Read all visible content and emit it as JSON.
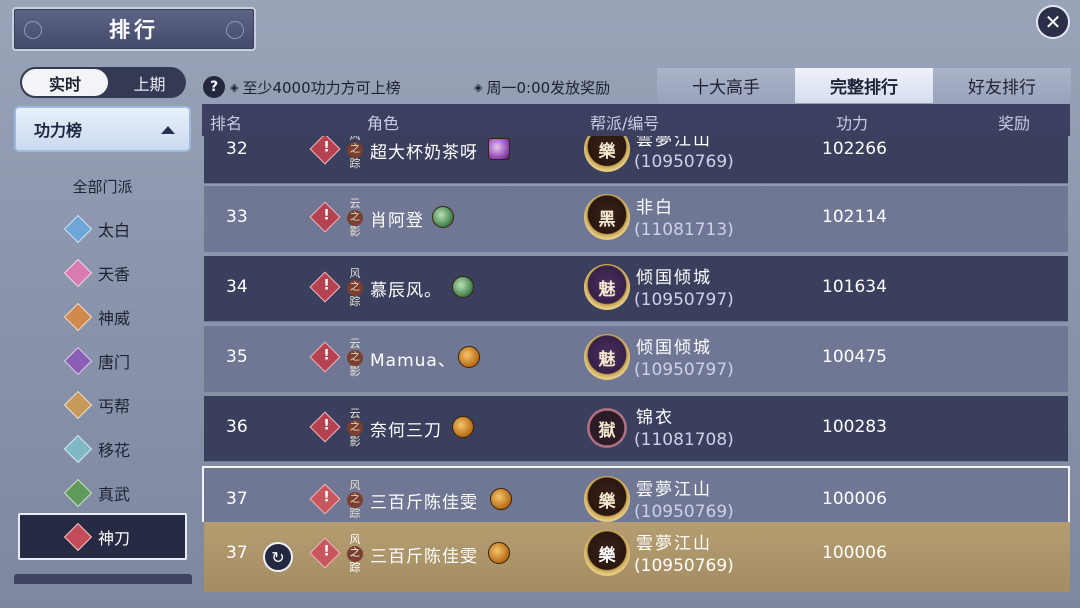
{
  "header": {
    "title": "排行",
    "close_icon": "close-icon"
  },
  "period_toggle": {
    "active": "实时",
    "inactive": "上期"
  },
  "category": {
    "label": "功力榜"
  },
  "sects": {
    "title": "全部门派",
    "items": [
      {
        "label": "太白",
        "color": "#6fa6d8"
      },
      {
        "label": "天香",
        "color": "#d77bb0"
      },
      {
        "label": "神威",
        "color": "#d08a4e"
      },
      {
        "label": "唐门",
        "color": "#8c5fb6"
      },
      {
        "label": "丐帮",
        "color": "#c79a5a"
      },
      {
        "label": "移花",
        "color": "#7fb9c4"
      },
      {
        "label": "真武",
        "color": "#5f9b5a"
      },
      {
        "label": "神刀",
        "color": "#c24c58"
      }
    ],
    "selected": "神刀"
  },
  "info": {
    "min_power": "至少4000功力方可上榜",
    "reward_time": "周一0:00发放奖励"
  },
  "tabs": [
    {
      "label": "十大高手",
      "active": false
    },
    {
      "label": "完整排行",
      "active": true
    },
    {
      "label": "好友排行",
      "active": false
    }
  ],
  "table": {
    "headers": {
      "rank": "排名",
      "role": "角色",
      "guild": "帮派/编号",
      "power": "功力",
      "reward": "奖励"
    },
    "rows": [
      {
        "rank": "32",
        "pet": [
          "风",
          "之",
          "踪"
        ],
        "name": "超大杯奶茶呀",
        "guild": "雲夢江山",
        "guild_emblem": "樂",
        "id": "(10950769)",
        "power": "102266"
      },
      {
        "rank": "33",
        "pet": [
          "云",
          "之",
          "影"
        ],
        "name": "肖阿登",
        "guild": "非白",
        "guild_emblem": "黑",
        "id": "(11081713)",
        "power": "102114"
      },
      {
        "rank": "34",
        "pet": [
          "风",
          "之",
          "踪"
        ],
        "name": "慕辰风。",
        "guild": "倾国倾城",
        "guild_emblem": "魅",
        "id": "(10950797)",
        "power": "101634"
      },
      {
        "rank": "35",
        "pet": [
          "云",
          "之",
          "影"
        ],
        "name": "Mamua、",
        "guild": "倾国倾城",
        "guild_emblem": "魅",
        "id": "(10950797)",
        "power": "100475"
      },
      {
        "rank": "36",
        "pet": [
          "云",
          "之",
          "影"
        ],
        "name": "奈何三刀",
        "guild": "锦衣",
        "guild_emblem": "獄",
        "id": "(11081708)",
        "power": "100283"
      },
      {
        "rank": "37",
        "pet": [
          "风",
          "之",
          "踪"
        ],
        "name": "三百斤陈佳雯",
        "guild": "雲夢江山",
        "guild_emblem": "樂",
        "id": "(10950769)",
        "power": "100006"
      }
    ],
    "self": {
      "rank": "37",
      "pet": [
        "风",
        "之",
        "踪"
      ],
      "name": "三百斤陈佳雯",
      "guild": "雲夢江山",
      "guild_emblem": "樂",
      "id": "(10950769)",
      "power": "100006"
    }
  }
}
